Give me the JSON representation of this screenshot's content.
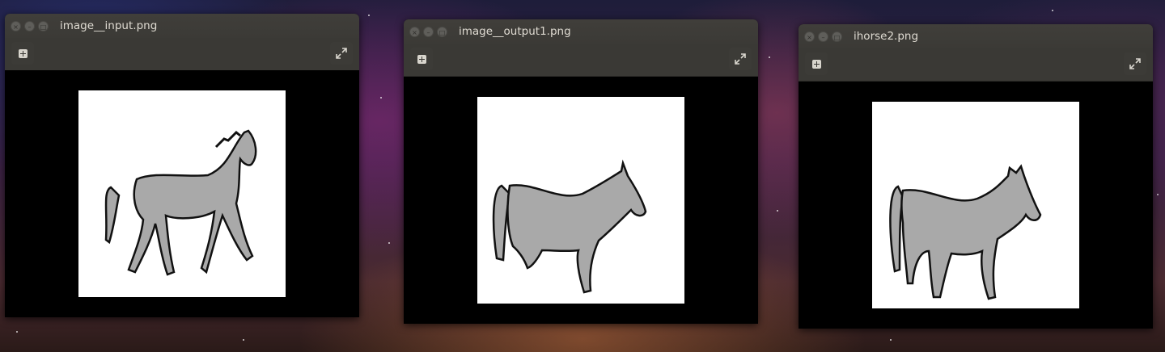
{
  "windows": [
    {
      "title": "image__input.png",
      "image_icon": "horse-drawing"
    },
    {
      "title": "image__output1.png",
      "image_icon": "horse-drawing"
    },
    {
      "title": "ihorse2.png",
      "image_icon": "horse-drawing"
    }
  ],
  "toolbar_icons": {
    "add": "plus-box-icon",
    "fullscreen": "expand-icon"
  },
  "controls": {
    "close": "×",
    "minimize": "–",
    "maximize": "□"
  },
  "colors": {
    "titlebar": "#3b3a36",
    "horse_fill": "#a9a9a9",
    "horse_outline": "#111111"
  }
}
